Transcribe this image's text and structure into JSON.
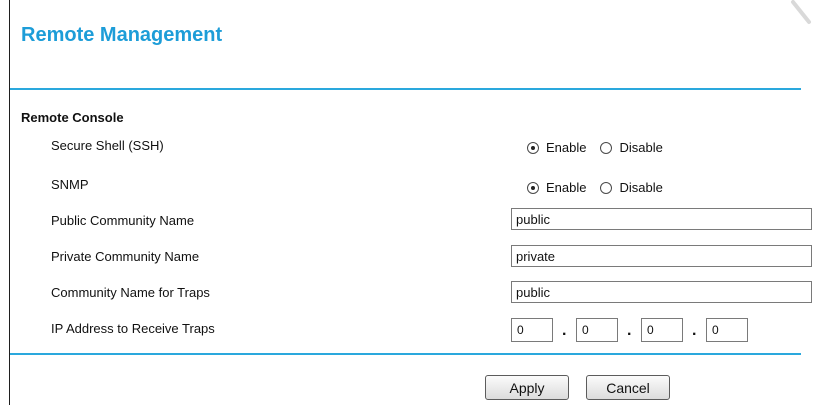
{
  "page": {
    "title": "Remote Management"
  },
  "remote_console": {
    "section_title": "Remote Console",
    "ssh": {
      "label": "Secure Shell (SSH)",
      "options": [
        "Enable",
        "Disable"
      ],
      "selected": "Enable"
    },
    "snmp": {
      "label": "SNMP",
      "options": [
        "Enable",
        "Disable"
      ],
      "selected": "Enable"
    },
    "public_community": {
      "label": "Public Community Name",
      "value": "public"
    },
    "private_community": {
      "label": "Private Community Name",
      "value": "private"
    },
    "trap_community": {
      "label": "Community Name for Traps",
      "value": "public"
    },
    "trap_ip": {
      "label": "IP Address to Receive Traps",
      "octets": [
        "0",
        "0",
        "0",
        "0"
      ],
      "separator": "."
    }
  },
  "actions": {
    "apply_label": "Apply",
    "cancel_label": "Cancel"
  },
  "colors": {
    "accent": "#1d9dd8",
    "rule": "#2aa8dd"
  }
}
